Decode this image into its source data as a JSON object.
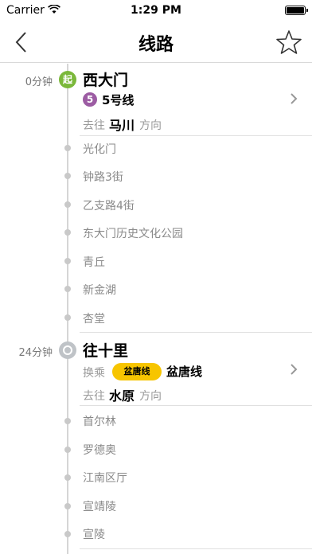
{
  "status": {
    "carrier": "Carrier",
    "time": "1:29 PM"
  },
  "nav": {
    "title": "线路"
  },
  "segments": [
    {
      "time": "0分钟",
      "badge": "起",
      "station": "西大门",
      "line_badge": "5",
      "line_name": "5号线",
      "direction_label": "去往",
      "direction_dest": "马川",
      "direction_suffix": "方向",
      "stops": [
        "光化门",
        "钟路3街",
        "乙支路4街",
        "东大门历史文化公园",
        "青丘",
        "新金湖",
        "杏堂"
      ]
    },
    {
      "time": "24分钟",
      "station": "往十里",
      "transfer_label": "换乘",
      "pill_label": "盆唐线",
      "line_name": "盆唐线",
      "direction_label": "去往",
      "direction_dest": "水原",
      "direction_suffix": "方向",
      "stops": [
        "首尔林",
        "罗德奥",
        "江南区厅",
        "宣靖陵",
        "宣陵"
      ]
    }
  ],
  "colors": {
    "start": "#7bb83b",
    "line5": "#9c5ca3",
    "bundang": "#f7c500",
    "transfer": "#bfc3c7"
  }
}
